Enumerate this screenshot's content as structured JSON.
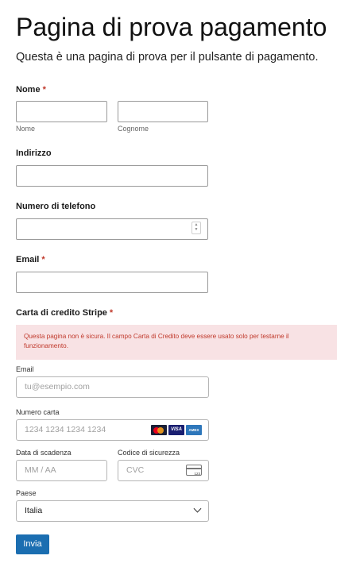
{
  "page": {
    "title": "Pagina di prova pagamento",
    "subtitle": "Questa è una pagina di prova per il pulsante di pagamento."
  },
  "form": {
    "name": {
      "label": "Nome",
      "required_mark": "*",
      "first_sublabel": "Nome",
      "last_sublabel": "Cognome",
      "first_value": "",
      "last_value": ""
    },
    "address": {
      "label": "Indirizzo",
      "value": ""
    },
    "phone": {
      "label": "Numero di telefono",
      "value": ""
    },
    "email": {
      "label": "Email",
      "required_mark": "*",
      "value": ""
    },
    "stripe": {
      "label": "Carta di credito Stripe",
      "required_mark": "*",
      "notice": "Questa pagina non è sicura. Il campo Carta di Credito deve essere usato solo per testarne il funzionamento.",
      "email_label": "Email",
      "email_placeholder": "tu@esempio.com",
      "card_label": "Numero carta",
      "card_placeholder": "1234 1234 1234 1234",
      "card_brands": [
        "mastercard-icon",
        "visa-icon",
        "amex-icon"
      ],
      "visa_text": "VISA",
      "amex_text": "AMEX",
      "expiry_label": "Data di scadenza",
      "expiry_placeholder": "MM / AA",
      "cvc_label": "Codice di sicurezza",
      "cvc_placeholder": "CVC",
      "cvc_icon_text": "123",
      "country_label": "Paese",
      "country_value": "Italia"
    },
    "submit_label": "Invia"
  },
  "colors": {
    "required": "#c0392b",
    "notice_bg": "#f8e2e4",
    "notice_text": "#c0392b",
    "button": "#1b6eb1"
  }
}
